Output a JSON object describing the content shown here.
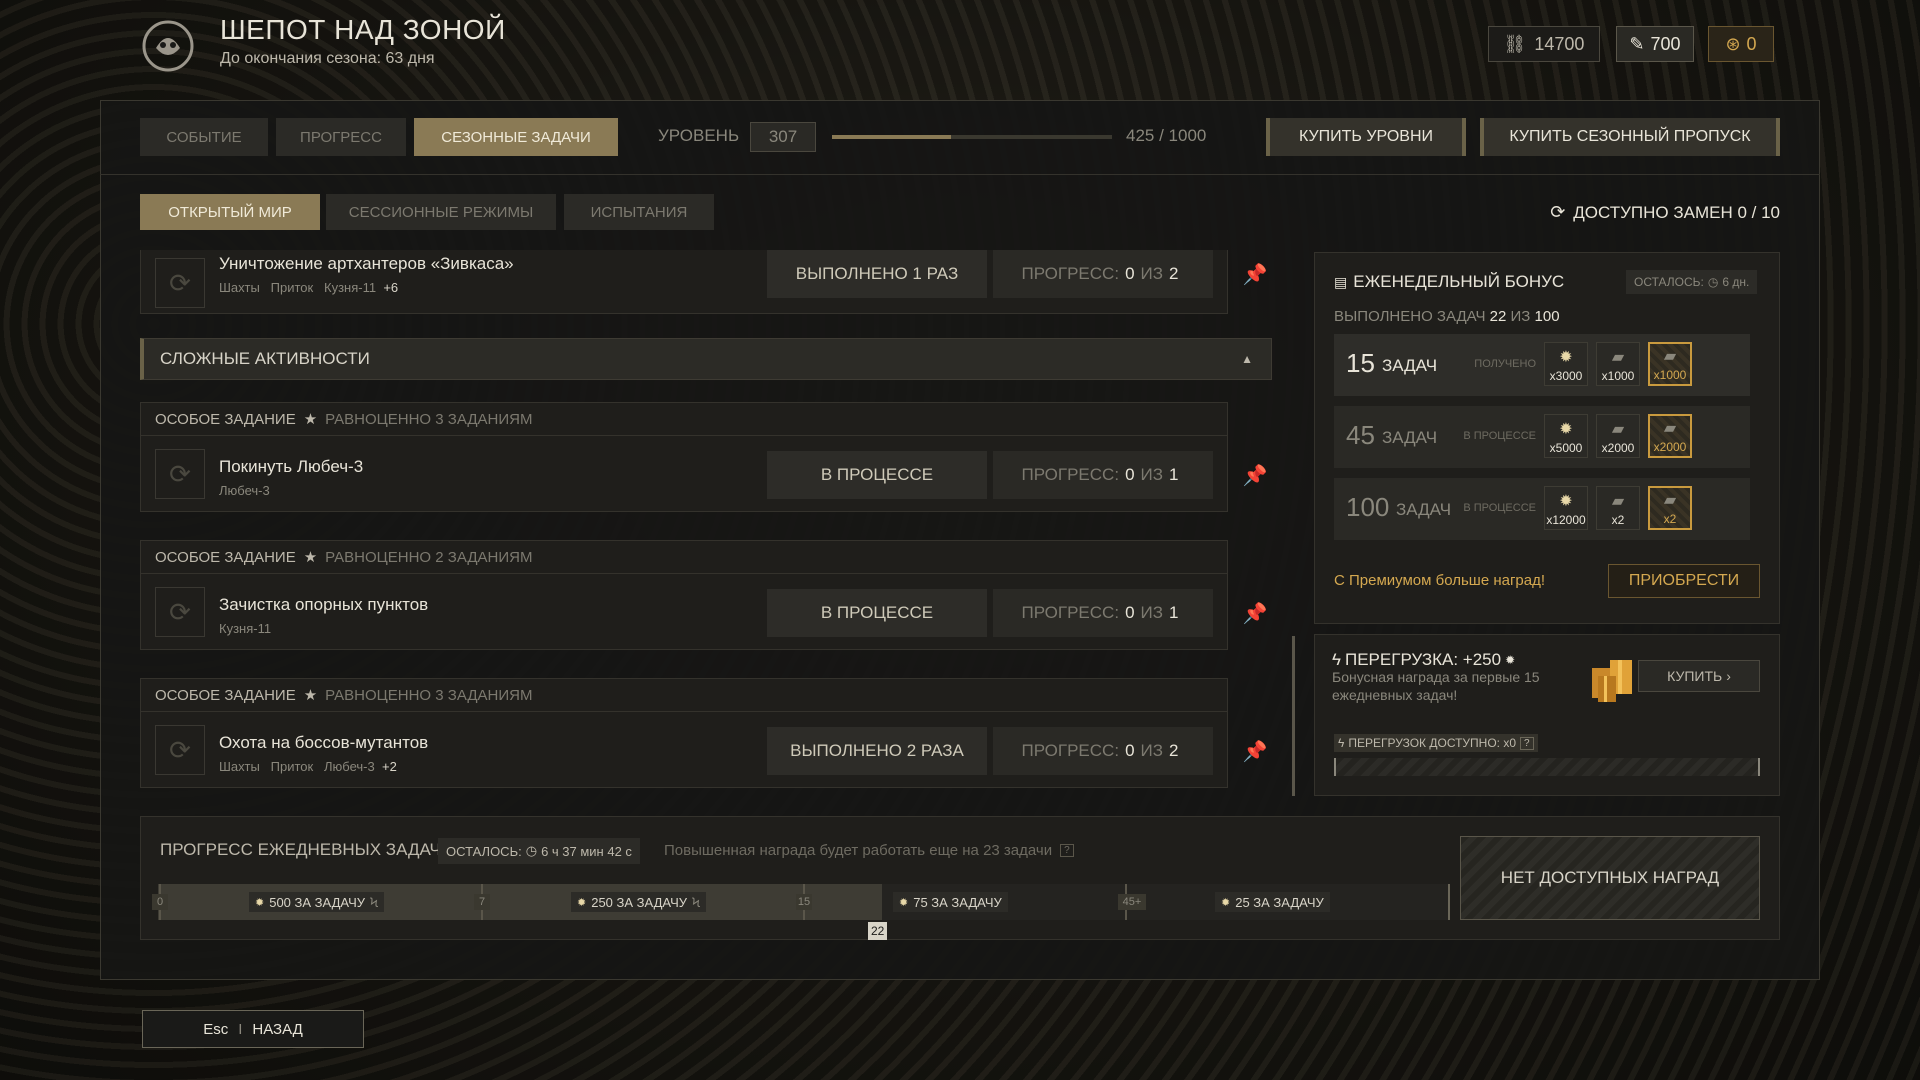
{
  "header": {
    "title": "ШЕПОТ НАД ЗОНОЙ",
    "subtitle": "До окончания сезона: 63 дня",
    "currencies": [
      {
        "icon": "link-currency-icon",
        "value": "14700"
      },
      {
        "icon": "feather-currency-icon",
        "value": "700"
      },
      {
        "icon": "coin-currency-icon",
        "value": "0"
      }
    ]
  },
  "tabs": [
    {
      "label": "СОБЫТИЕ"
    },
    {
      "label": "ПРОГРЕСС"
    },
    {
      "label": "СЕЗОННЫЕ ЗАДАЧИ"
    }
  ],
  "level": {
    "label": "УРОВЕНЬ",
    "value": "307",
    "progress_text": "425 / 1000",
    "progress_fraction": 0.425
  },
  "buy_levels": "КУПИТЬ УРОВНИ",
  "buy_pass": "КУПИТЬ СЕЗОННЫЙ ПРОПУСК",
  "subtabs": [
    {
      "label": "ОТКРЫТЫЙ МИР"
    },
    {
      "label": "СЕССИОННЫЕ РЕЖИМЫ"
    },
    {
      "label": "ИСПЫТАНИЯ"
    }
  ],
  "replacements": "ДОСТУПНО ЗАМЕН 0 / 10",
  "tasks_top": {
    "title": "Уничтожение артхантеров «Зивкаса»",
    "locations": "Шахты   Приток   Кузня-11",
    "more": "+6",
    "status": "ВЫПОЛНЕНО 1 РАЗ",
    "progress_prefix": "ПРОГРЕСС:",
    "progress_cur": "0",
    "progress_of": "ИЗ",
    "progress_max": "2"
  },
  "complex_header": "СЛОЖНЫЕ АКТИВНОСТИ",
  "special_tasks": [
    {
      "label": "ОСОБОЕ ЗАДАНИЕ",
      "equiv": "РАВНОЦЕННО 3 ЗАДАНИЯМ",
      "title": "Покинуть Любеч-3",
      "locations": "Любеч-3",
      "more": "",
      "status": "В ПРОЦЕССЕ",
      "progress_prefix": "ПРОГРЕСС:",
      "progress_cur": "0",
      "progress_of": "ИЗ",
      "progress_max": "1"
    },
    {
      "label": "ОСОБОЕ ЗАДАНИЕ",
      "equiv": "РАВНОЦЕННО 2 ЗАДАНИЯМ",
      "title": "Зачистка опорных пунктов",
      "locations": "Кузня-11",
      "more": "",
      "status": "В ПРОЦЕССЕ",
      "progress_prefix": "ПРОГРЕСС:",
      "progress_cur": "0",
      "progress_of": "ИЗ",
      "progress_max": "1"
    },
    {
      "label": "ОСОБОЕ ЗАДАНИЕ",
      "equiv": "РАВНОЦЕННО 3 ЗАДАНИЯМ",
      "title": "Охота на боссов-мутантов",
      "locations": "Шахты   Приток   Любеч-3",
      "more": "+2",
      "status": "ВЫПОЛНЕНО 2 РАЗА",
      "progress_prefix": "ПРОГРЕСС:",
      "progress_cur": "0",
      "progress_of": "ИЗ",
      "progress_max": "2"
    }
  ],
  "weekly": {
    "title": "ЕЖЕНЕДЕЛЬНЫЙ БОНУС",
    "remaining": "ОСТАЛОСЬ:",
    "remaining_time": "6 дн.",
    "done_label": "ВЫПОЛНЕНО ЗАДАЧ",
    "done_cur": "22",
    "done_of": "ИЗ",
    "done_max": "100",
    "tiers": [
      {
        "num": "15",
        "word": "ЗАДАЧ",
        "state": "ПОЛУЧЕНО",
        "rewards": [
          "x3000",
          "x1000",
          "x1000"
        ]
      },
      {
        "num": "45",
        "word": "ЗАДАЧ",
        "state": "В ПРОЦЕССЕ",
        "rewards": [
          "x5000",
          "x2000",
          "x2000"
        ]
      },
      {
        "num": "100",
        "word": "ЗАДАЧ",
        "state": "В ПРОЦЕССЕ",
        "rewards": [
          "x12000",
          "x2",
          "x2"
        ]
      }
    ],
    "premium_text": "С Премиумом больше наград!",
    "premium_button": "ПРИОБРЕСТИ"
  },
  "overload": {
    "title": "ПЕРЕГРУЗКА: +250",
    "desc": "Бонусная награда за первые 15 ежедневных задач!",
    "buy": "КУПИТЬ",
    "available": "ПЕРЕГРУЗОК ДОСТУПНО: x0",
    "help": "?"
  },
  "daily": {
    "title": "ПРОГРЕСС ЕЖЕДНЕВНЫХ ЗАДАЧ",
    "remaining": "ОСТАЛОСЬ:",
    "remaining_time": "6 ч 37 мин 42 с",
    "note": "Повышенная награда будет работать еще на 23 задачи",
    "help": "?",
    "ticks": [
      "0",
      "7",
      "15",
      "45+"
    ],
    "segments": [
      "500 ЗА ЗАДАЧУ",
      "250 ЗА ЗАДАЧУ",
      "75 ЗА ЗАДАЧУ",
      "25 ЗА ЗАДАЧУ"
    ],
    "current": "22",
    "no_rewards": "НЕТ ДОСТУПНЫХ НАГРАД"
  },
  "back": {
    "key": "Esc",
    "label": "НАЗАД"
  },
  "colors": {
    "accent": "#8a7a55",
    "gold": "#d4a850",
    "bg": "#161614"
  }
}
